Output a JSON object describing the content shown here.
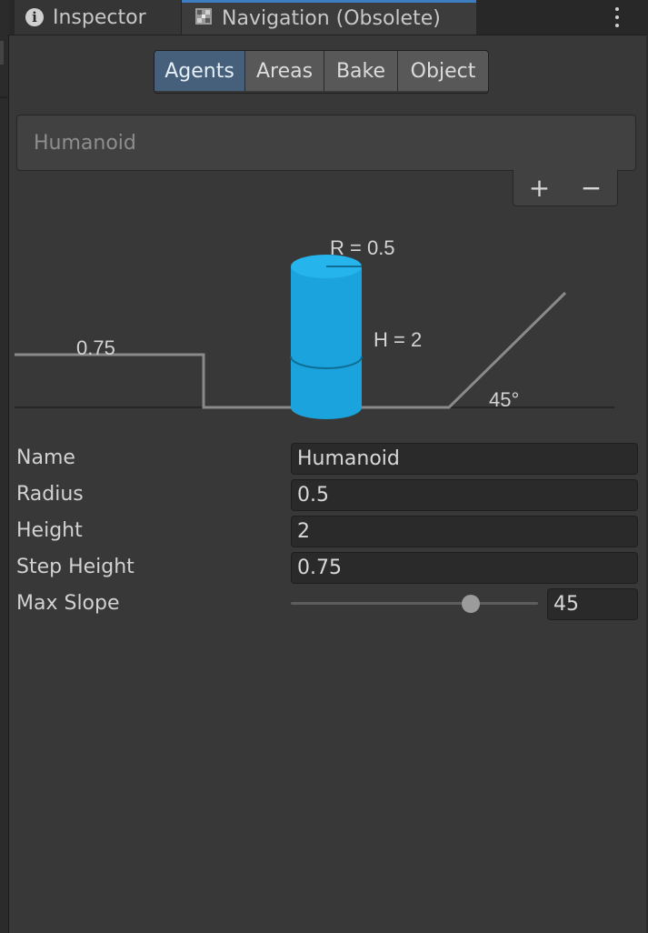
{
  "tabs": [
    {
      "label": "Inspector",
      "icon": "info-icon",
      "active": false
    },
    {
      "label": "Navigation (Obsolete)",
      "icon": "navigation-icon",
      "active": true
    }
  ],
  "toolbar": {
    "buttons": [
      "Agents",
      "Areas",
      "Bake",
      "Object"
    ],
    "active": "Agents"
  },
  "agent_list": {
    "items": [
      "Humanoid"
    ],
    "add_label": "+",
    "remove_label": "−"
  },
  "diagram": {
    "radius_label": "R = 0.5",
    "height_label": "H = 2",
    "step_label": "0.75",
    "slope_label": "45°"
  },
  "properties": {
    "name": {
      "label": "Name",
      "value": "Humanoid"
    },
    "radius": {
      "label": "Radius",
      "value": "0.5"
    },
    "height": {
      "label": "Height",
      "value": "2"
    },
    "step_height": {
      "label": "Step Height",
      "value": "0.75"
    },
    "max_slope": {
      "label": "Max Slope",
      "value": "45",
      "slider_min": 0,
      "slider_max": 60
    }
  },
  "colors": {
    "accent": "#46607c",
    "agent_cylinder": "#1aa3dc",
    "background": "#383838"
  }
}
